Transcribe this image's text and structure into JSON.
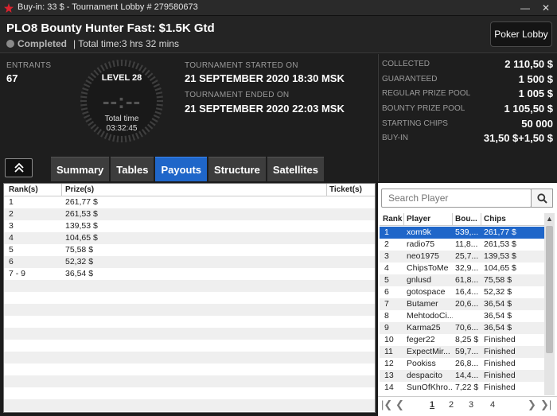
{
  "window": {
    "title": "Buy-in: 33 $ - Tournament Lobby # 279580673",
    "minimize_icon": "minimize-icon",
    "close_icon": "close-icon"
  },
  "header": {
    "tournament_name": "PLO8 Bounty Hunter Fast: $1.5K Gtd",
    "status": "Completed",
    "total_time": "| Total time:3 hrs  32 mins",
    "lobby_button": "Poker Lobby"
  },
  "info": {
    "entrants_label": "ENTRANTS",
    "entrants_value": "67",
    "level": "LEVEL 28",
    "clock_digits": "--:--",
    "total_time_label": "Total time",
    "total_time_value": "03:32:45",
    "started_label": "TOURNAMENT STARTED ON",
    "started_value": "21 SEPTEMBER 2020   18:30 MSK",
    "ended_label": "TOURNAMENT ENDED ON",
    "ended_value": "21 SEPTEMBER 2020   22:03 MSK"
  },
  "tabs": [
    {
      "label": "Summary"
    },
    {
      "label": "Tables"
    },
    {
      "label": "Payouts",
      "active": true
    },
    {
      "label": "Structure"
    },
    {
      "label": "Satellites"
    }
  ],
  "stats": [
    {
      "label": "COLLECTED",
      "value": "2 110,50 $"
    },
    {
      "label": "GUARANTEED",
      "value": "1 500 $"
    },
    {
      "label": "REGULAR PRIZE POOL",
      "value": "1 005 $"
    },
    {
      "label": "BOUNTY PRIZE POOL",
      "value": "1 105,50 $"
    },
    {
      "label": "STARTING CHIPS",
      "value": "50 000"
    },
    {
      "label": "BUY-IN",
      "value": "31,50 $+1,50 $"
    }
  ],
  "payouts": {
    "columns": [
      "Rank(s)",
      "Prize(s)",
      "Ticket(s)"
    ],
    "rows": [
      {
        "rank": "1",
        "prize": "261,77 $"
      },
      {
        "rank": "2",
        "prize": "261,53 $"
      },
      {
        "rank": "3",
        "prize": "139,53 $"
      },
      {
        "rank": "4",
        "prize": "104,65 $"
      },
      {
        "rank": "5",
        "prize": "75,58 $"
      },
      {
        "rank": "6",
        "prize": "52,32 $"
      },
      {
        "rank": "7 - 9",
        "prize": "36,54 $"
      }
    ]
  },
  "players": {
    "search_placeholder": "Search Player",
    "columns": [
      "Rank",
      "Player",
      "Bou...",
      "Chips"
    ],
    "rows": [
      {
        "rank": "1",
        "player": "xom9k",
        "bounty": "539,...",
        "chips": "261,77 $",
        "selected": true
      },
      {
        "rank": "2",
        "player": "radio75",
        "bounty": "11,8...",
        "chips": "261,53 $"
      },
      {
        "rank": "3",
        "player": "neo1975",
        "bounty": "25,7...",
        "chips": "139,53 $"
      },
      {
        "rank": "4",
        "player": "ChipsToMe",
        "bounty": "32,9...",
        "chips": "104,65 $"
      },
      {
        "rank": "5",
        "player": "gnlusd",
        "bounty": "61,8...",
        "chips": "75,58 $"
      },
      {
        "rank": "6",
        "player": "gotospace",
        "bounty": "16,4...",
        "chips": "52,32 $"
      },
      {
        "rank": "7",
        "player": "Butamer",
        "bounty": "20,6...",
        "chips": "36,54 $"
      },
      {
        "rank": "8",
        "player": "MehtodoCi...",
        "bounty": "",
        "chips": "36,54 $"
      },
      {
        "rank": "9",
        "player": "Karma25",
        "bounty": "70,6...",
        "chips": "36,54 $"
      },
      {
        "rank": "10",
        "player": "feger22",
        "bounty": "8,25 $",
        "chips": "Finished"
      },
      {
        "rank": "11",
        "player": "ExpectMir...",
        "bounty": "59,7...",
        "chips": "Finished"
      },
      {
        "rank": "12",
        "player": "Pookiss",
        "bounty": "26,8...",
        "chips": "Finished"
      },
      {
        "rank": "13",
        "player": "despacito",
        "bounty": "14,4...",
        "chips": "Finished"
      },
      {
        "rank": "14",
        "player": "SunOfKhro...",
        "bounty": "7,22 $",
        "chips": "Finished"
      }
    ],
    "pages": [
      "1",
      "2",
      "3",
      "4"
    ],
    "current_page": "1"
  }
}
